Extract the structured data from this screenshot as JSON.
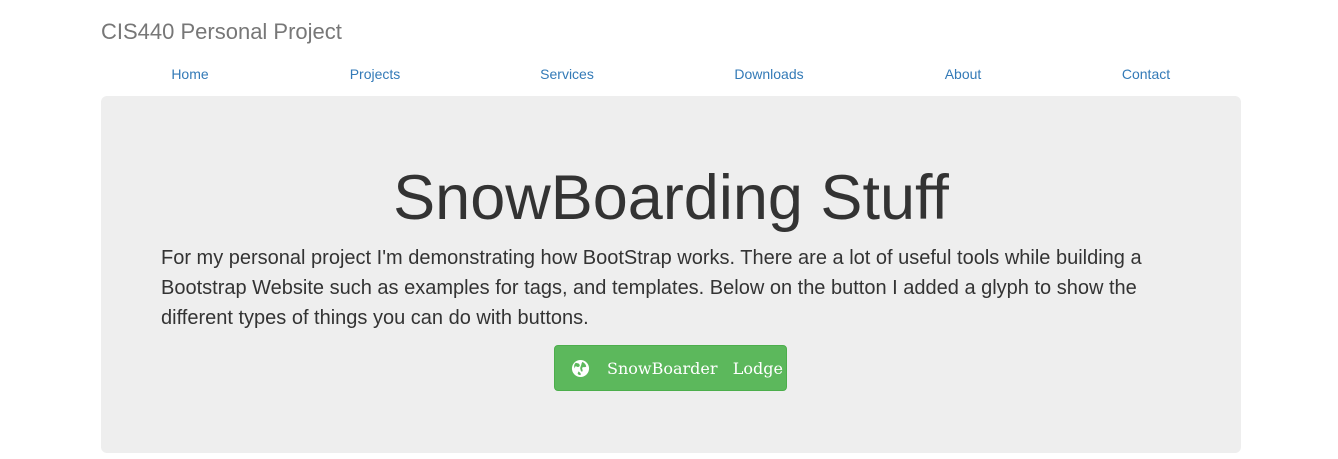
{
  "brand": {
    "title": "CIS440 Personal Project"
  },
  "nav": {
    "items": [
      {
        "label": "Home"
      },
      {
        "label": "Projects"
      },
      {
        "label": "Services"
      },
      {
        "label": "Downloads"
      },
      {
        "label": "About"
      },
      {
        "label": "Contact"
      }
    ]
  },
  "jumbotron": {
    "heading": "SnowBoarding Stuff",
    "body": "For my personal project I'm demonstrating how BootStrap works. There are a lot of useful tools while building a Bootstrap Website such as examples for tags, and templates. Below on the button I added a glyph to show the different types of things you can do with buttons.",
    "button": {
      "label": "SnowBoarder   Lodge",
      "icon": "globe-icon"
    }
  },
  "colors": {
    "link": "#337ab7",
    "brand_text": "#777777",
    "jumbotron_bg": "#eeeeee",
    "button_bg": "#5cb85c",
    "text": "#333333"
  }
}
